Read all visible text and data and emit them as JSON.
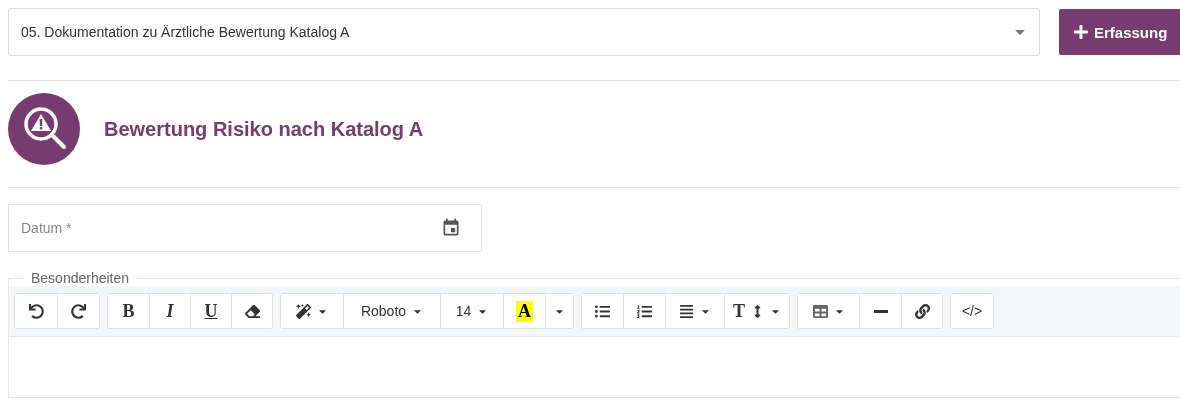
{
  "record_select": {
    "value": "05. Dokumentation zu Ärztliche Bewertung Katalog A"
  },
  "add_button": {
    "label": "Erfassung"
  },
  "section": {
    "title": "Bewertung Risiko nach Katalog A"
  },
  "date_field": {
    "placeholder": "Datum *"
  },
  "editor": {
    "legend": "Besonderheiten",
    "toolbar": [
      [
        {
          "kind": "undo",
          "dropdown": false
        },
        {
          "kind": "redo",
          "dropdown": false
        }
      ],
      [
        {
          "kind": "bold",
          "label": "B",
          "dropdown": false
        },
        {
          "kind": "italic",
          "label": "I",
          "dropdown": false
        },
        {
          "kind": "underline",
          "label": "U",
          "dropdown": false
        },
        {
          "kind": "eraser",
          "dropdown": false
        }
      ],
      [
        {
          "kind": "magic",
          "dropdown": true
        },
        {
          "kind": "font",
          "label": "Roboto",
          "dropdown": true
        },
        {
          "kind": "size",
          "label": "14",
          "dropdown": true
        },
        {
          "kind": "highlight",
          "label": "A",
          "dropdown": false
        },
        {
          "kind": "caret",
          "dropdown": true
        }
      ],
      [
        {
          "kind": "bullets",
          "dropdown": false
        },
        {
          "kind": "numbered",
          "dropdown": false
        },
        {
          "kind": "align",
          "dropdown": true
        },
        {
          "kind": "textheight",
          "label": "T",
          "dropdown": true
        }
      ],
      [
        {
          "kind": "table",
          "dropdown": true
        },
        {
          "kind": "rule",
          "dropdown": false
        },
        {
          "kind": "link",
          "dropdown": false
        }
      ],
      [
        {
          "kind": "code",
          "label": "</>",
          "dropdown": false
        }
      ]
    ]
  }
}
